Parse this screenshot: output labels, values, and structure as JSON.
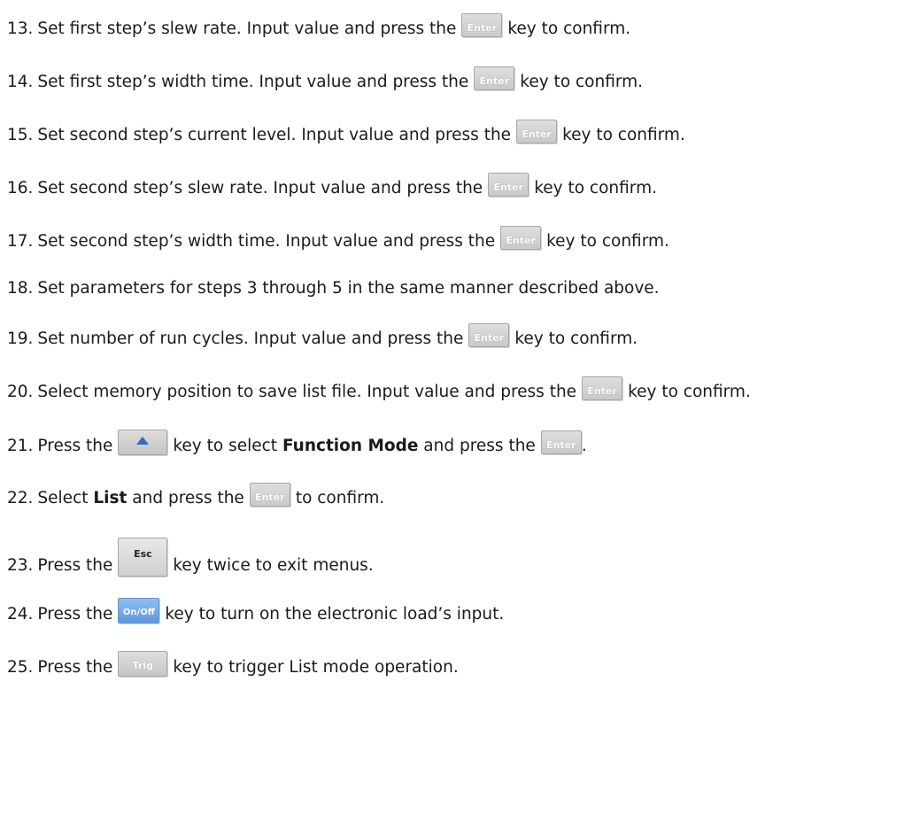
{
  "keys": {
    "enter": "Enter",
    "esc": "Esc",
    "onoff": "On/Off",
    "trig": "Trig",
    "up_icon": "up-arrow-icon"
  },
  "steps": [
    {
      "num": "13.",
      "before": "Set first step’s slew rate. Input value and press the",
      "after": "key to confirm."
    },
    {
      "num": "14.",
      "before": "Set first step’s width time. Input value and press the",
      "after": "key to confirm."
    },
    {
      "num": "15.",
      "before": "Set second step’s current level. Input value and press the",
      "after": "key to confirm."
    },
    {
      "num": "16.",
      "before": "Set second step’s slew rate. Input value and press the",
      "after": "key to confirm."
    },
    {
      "num": "17.",
      "before": "Set second step’s width time. Input value and press the",
      "after": "key to confirm."
    },
    {
      "num": "18.",
      "text": "Set parameters for steps 3 through 5 in the same manner described above."
    },
    {
      "num": "19.",
      "before": "Set number of run cycles. Input value and press the",
      "after": "key to confirm."
    },
    {
      "num": "20.",
      "before": "Select memory position to save list file. Input value and press the",
      "after": "key to confirm."
    },
    {
      "num": "21.",
      "before": "Press the",
      "middle": "key to select",
      "bold": "Function Mode",
      "middle2": "and press the",
      "after": "."
    },
    {
      "num": "22.",
      "before": "Select",
      "bold": "List",
      "middle": "and press the",
      "after": "to confirm."
    },
    {
      "num": "23.",
      "before": "Press the",
      "after": "key twice to exit menus."
    },
    {
      "num": "24.",
      "before": "Press the",
      "after": "key to turn on the electronic load’s input."
    },
    {
      "num": "25.",
      "before": "Press the",
      "after": "key to trigger List mode operation."
    }
  ]
}
